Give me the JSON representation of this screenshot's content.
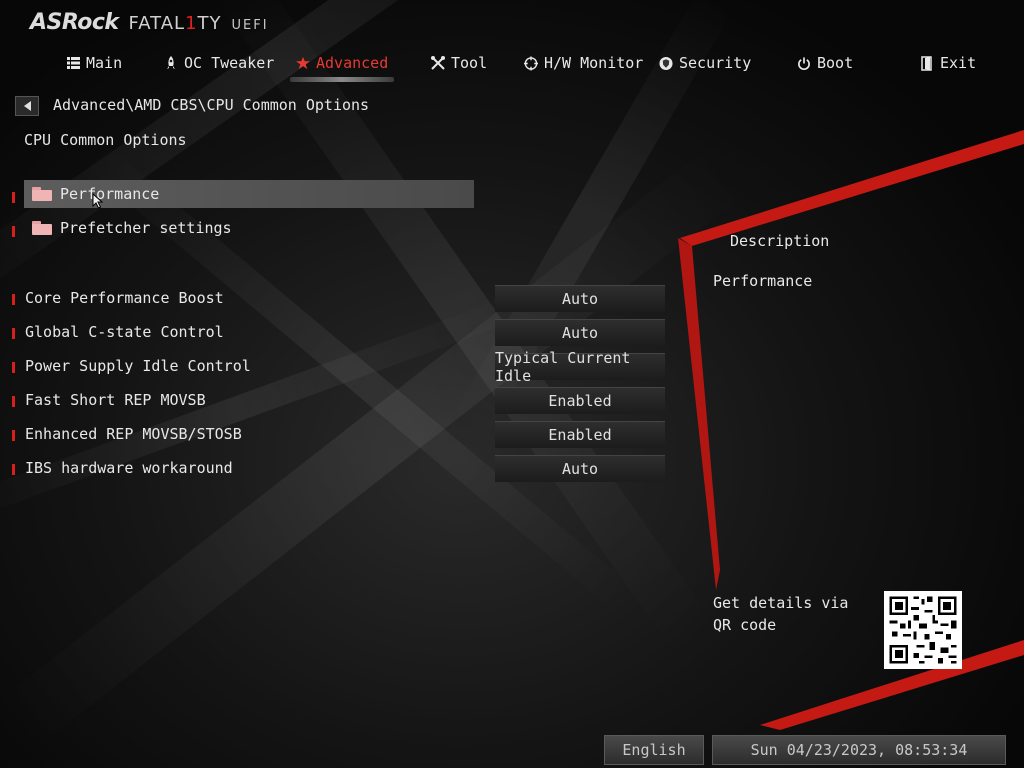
{
  "logo": {
    "brand": "ASRock",
    "fatal_a": "FATAL",
    "fatal_one": "1",
    "fatal_b": "TY",
    "uefi": "UEFI"
  },
  "nav": [
    {
      "label": "Main",
      "icon": "list-icon"
    },
    {
      "label": "OC Tweaker",
      "icon": "rocket-icon"
    },
    {
      "label": "Advanced",
      "icon": "star-icon",
      "active": true
    },
    {
      "label": "Tool",
      "icon": "tools-icon"
    },
    {
      "label": "H/W Monitor",
      "icon": "crosshair-icon"
    },
    {
      "label": "Security",
      "icon": "shield-icon"
    },
    {
      "label": "Boot",
      "icon": "power-icon"
    },
    {
      "label": "Exit",
      "icon": "exit-door-icon"
    }
  ],
  "breadcrumb": "Advanced\\AMD CBS\\CPU Common Options",
  "page_title": "CPU Common Options",
  "submenus": [
    {
      "label": "Performance",
      "selected": true
    },
    {
      "label": "Prefetcher settings",
      "selected": false
    }
  ],
  "options": [
    {
      "label": "Core Performance Boost",
      "value": "Auto"
    },
    {
      "label": "Global C-state Control",
      "value": "Auto"
    },
    {
      "label": "Power Supply Idle Control",
      "value": "Typical Current Idle"
    },
    {
      "label": "Fast Short REP MOVSB",
      "value": "Enabled"
    },
    {
      "label": "Enhanced REP MOVSB/STOSB",
      "value": "Enabled"
    },
    {
      "label": "IBS hardware workaround",
      "value": "Auto"
    }
  ],
  "description": {
    "title": "Description",
    "text": "Performance"
  },
  "qr_text": "Get details via QR code",
  "footer": {
    "language": "English",
    "datetime": "Sun 04/23/2023, 08:53:34"
  },
  "colors": {
    "accent": "#e0201c",
    "selected_row": "#555555"
  }
}
